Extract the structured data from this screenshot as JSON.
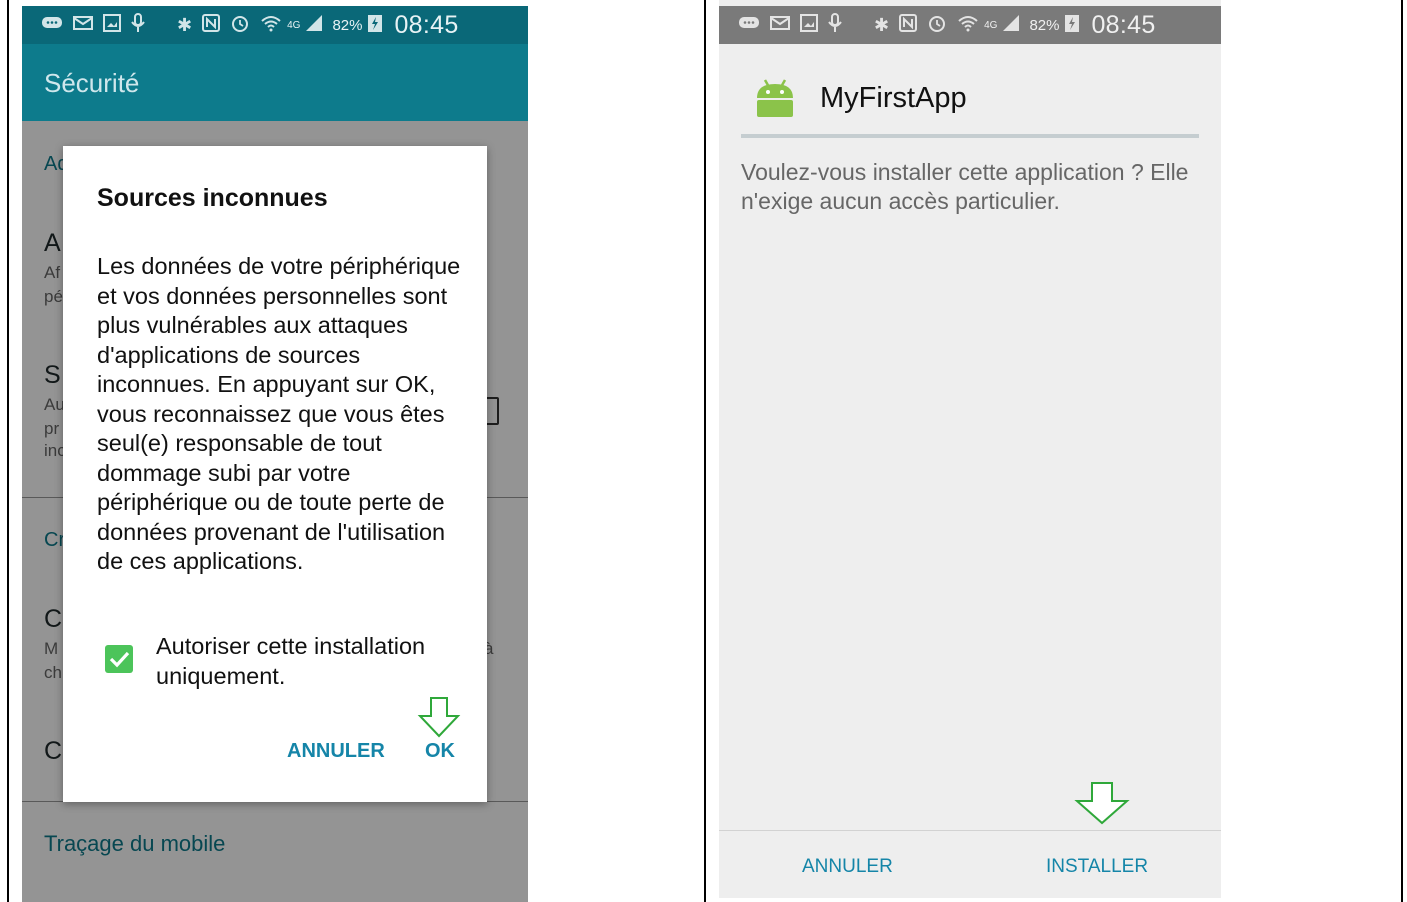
{
  "left_screen": {
    "status_bar": {
      "time": "08:45",
      "battery_pct": "82%",
      "network": "4G"
    },
    "app_bar": {
      "title": "Sécurité"
    },
    "background_rows": [
      {
        "text": "Ad",
        "cls": "sec"
      },
      {
        "text": "A",
        "cls": "item"
      },
      {
        "text": "Af",
        "cls": "sub"
      },
      {
        "text": "pé",
        "cls": "sub"
      },
      {
        "text": "S",
        "cls": "item"
      },
      {
        "text": "Au",
        "cls": "sub"
      },
      {
        "text": "pr",
        "cls": "sub"
      },
      {
        "text": "inc",
        "cls": "sub"
      },
      {
        "text": "Cr",
        "cls": "sec"
      },
      {
        "text": "C",
        "cls": "item"
      },
      {
        "text": "M",
        "cls": "sub"
      },
      {
        "text": "ch",
        "cls": "sub"
      },
      {
        "text": "C",
        "cls": "item"
      }
    ],
    "bg_right_fragment": "à",
    "footer_link": "Traçage du mobile",
    "dialog": {
      "title": "Sources inconnues",
      "message": "Les données de votre périphérique et vos données personnelles sont plus vulnérables aux attaques d'applications de sources inconnues. En appuyant sur OK, vous reconnaissez que vous êtes seul(e) responsable de tout dommage subi par votre périphérique ou de toute perte de données provenant de l'utilisation de ces applications.",
      "checkbox_label": "Autoriser cette installation uniquement.",
      "checkbox_checked": true,
      "cancel_label": "ANNULER",
      "ok_label": "OK"
    }
  },
  "right_screen": {
    "status_bar": {
      "time": "08:45",
      "battery_pct": "82%",
      "network": "4G"
    },
    "app_name": "MyFirstApp",
    "install_message": "Voulez-vous installer cette application ? Elle n'exige aucun accès particulier.",
    "cancel_label": "ANNULER",
    "install_label": "INSTALLER"
  },
  "colors": {
    "teal": "#0d7b8c",
    "accent_blue": "#1585a8",
    "checkbox_green": "#4cc45a",
    "arrow_green": "#2fa83a",
    "android_green": "#8bc34a"
  }
}
